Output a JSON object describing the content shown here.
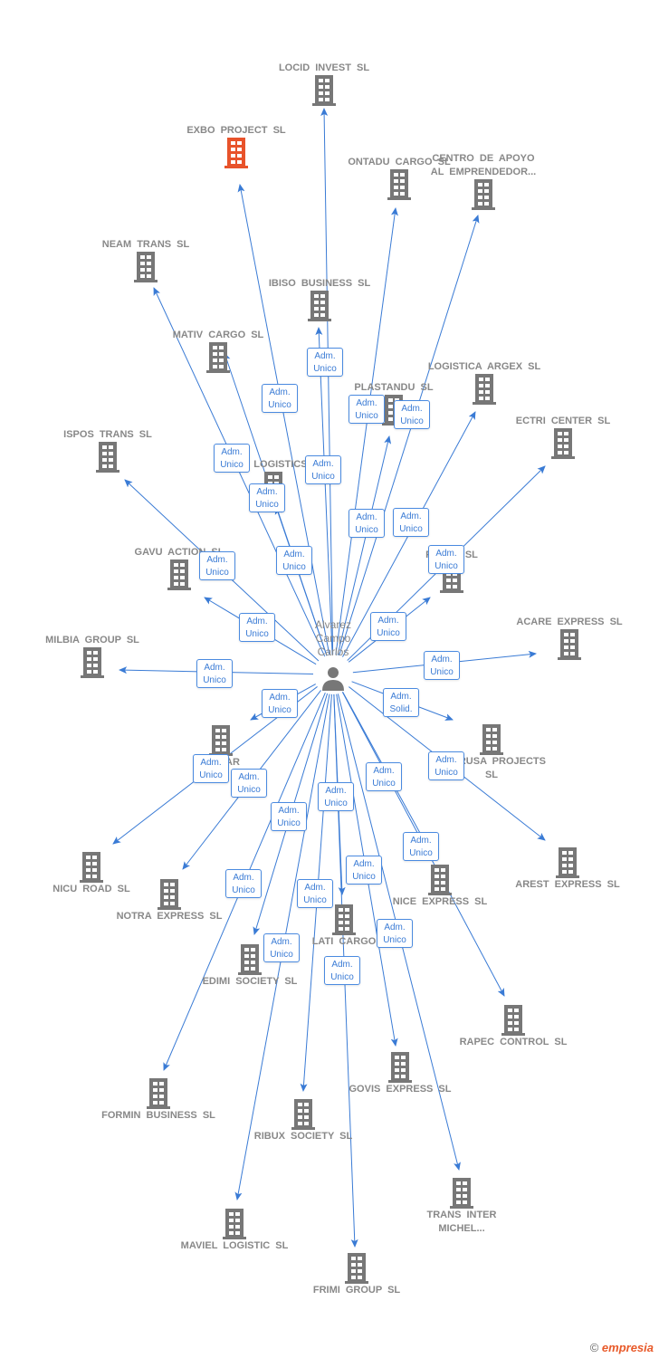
{
  "center_person": {
    "name": "Alvarez Campo Carlos",
    "icon": "person-icon"
  },
  "colors": {
    "edge": "#3a7bd5",
    "building": "#777777",
    "highlight": "#e8532b"
  },
  "companies": [
    {
      "name": "LOCID INVEST SL"
    },
    {
      "name": "EXBO PROJECT SL",
      "highlighted": true
    },
    {
      "name": "ONTADU CARGO SL"
    },
    {
      "name": "CENTRO DE APOYO AL EMPRENDEDOR..."
    },
    {
      "name": "NEAM TRANS SL"
    },
    {
      "name": "IBISO BUSINESS SL"
    },
    {
      "name": "MATIV CARGO SL"
    },
    {
      "name": "PLASTANDU SL"
    },
    {
      "name": "LOGISTICA ARGEX SL"
    },
    {
      "name": "ECTRI CENTER SL"
    },
    {
      "name": "ISPOS TRANS SL"
    },
    {
      "name": "FRED LOGISTICS SL"
    },
    {
      "name": "GAVU ACTION SL"
    },
    {
      "name": "PAREC SL"
    },
    {
      "name": "ACARE EXPRESS SL"
    },
    {
      "name": "MILBIA GROUP SL"
    },
    {
      "name": "NEGRUSA PROJECTS SL"
    },
    {
      "name": "F STAR"
    },
    {
      "name": "NICU ROAD SL"
    },
    {
      "name": "AREST EXPRESS SL"
    },
    {
      "name": "NOTRA EXPRESS SL"
    },
    {
      "name": "NICE EXPRESS SL"
    },
    {
      "name": "LATI CARGO"
    },
    {
      "name": "EDIMI SOCIETY SL"
    },
    {
      "name": "RAPEC CONTROL SL"
    },
    {
      "name": "GOVIS EXPRESS SL"
    },
    {
      "name": "FORMIN BUSINESS SL"
    },
    {
      "name": "RIBUX SOCIETY SL"
    },
    {
      "name": "MAVIEL LOGISTIC SL"
    },
    {
      "name": "TRANS INTER MICHEL..."
    },
    {
      "name": "FRIMI GROUP SL"
    }
  ],
  "roles": [
    {
      "l1": "Adm.",
      "l2": "Unico"
    },
    {
      "l1": "Adm.",
      "l2": "Unico"
    },
    {
      "l1": "Adm.",
      "l2": "Unico"
    },
    {
      "l1": "Adm.",
      "l2": "Unico"
    },
    {
      "l1": "Adm.",
      "l2": "Unico"
    },
    {
      "l1": "Adm.",
      "l2": "Unico"
    },
    {
      "l1": "Adm.",
      "l2": "Unico"
    },
    {
      "l1": "Adm.",
      "l2": "Unico"
    },
    {
      "l1": "Adm.",
      "l2": "Unico"
    },
    {
      "l1": "Adm.",
      "l2": "Unico"
    },
    {
      "l1": "Adm.",
      "l2": "Unico"
    },
    {
      "l1": "Adm.",
      "l2": "Unico"
    },
    {
      "l1": "Adm.",
      "l2": "Unico"
    },
    {
      "l1": "Adm.",
      "l2": "Unico"
    },
    {
      "l1": "Adm.",
      "l2": "Unico"
    },
    {
      "l1": "Adm.",
      "l2": "Unico"
    },
    {
      "l1": "Adm.",
      "l2": "Unico"
    },
    {
      "l1": "Adm.",
      "l2": "Solid."
    },
    {
      "l1": "Adm.",
      "l2": "Unico"
    },
    {
      "l1": "Adm.",
      "l2": "Unico"
    },
    {
      "l1": "Adm.",
      "l2": "Unico"
    },
    {
      "l1": "Adm.",
      "l2": "Unico"
    },
    {
      "l1": "Adm.",
      "l2": "Unico"
    },
    {
      "l1": "Adm.",
      "l2": "Unico"
    },
    {
      "l1": "Adm.",
      "l2": "Unico"
    },
    {
      "l1": "Adm.",
      "l2": "Unico"
    },
    {
      "l1": "Adm.",
      "l2": "Unico"
    },
    {
      "l1": "Adm.",
      "l2": "Unico"
    },
    {
      "l1": "Adm.",
      "l2": "Unico"
    },
    {
      "l1": "Adm.",
      "l2": "Unico"
    },
    {
      "l1": "Adm.",
      "l2": "Unico"
    }
  ],
  "footer": {
    "copyright": "©",
    "brand": "empresia"
  }
}
